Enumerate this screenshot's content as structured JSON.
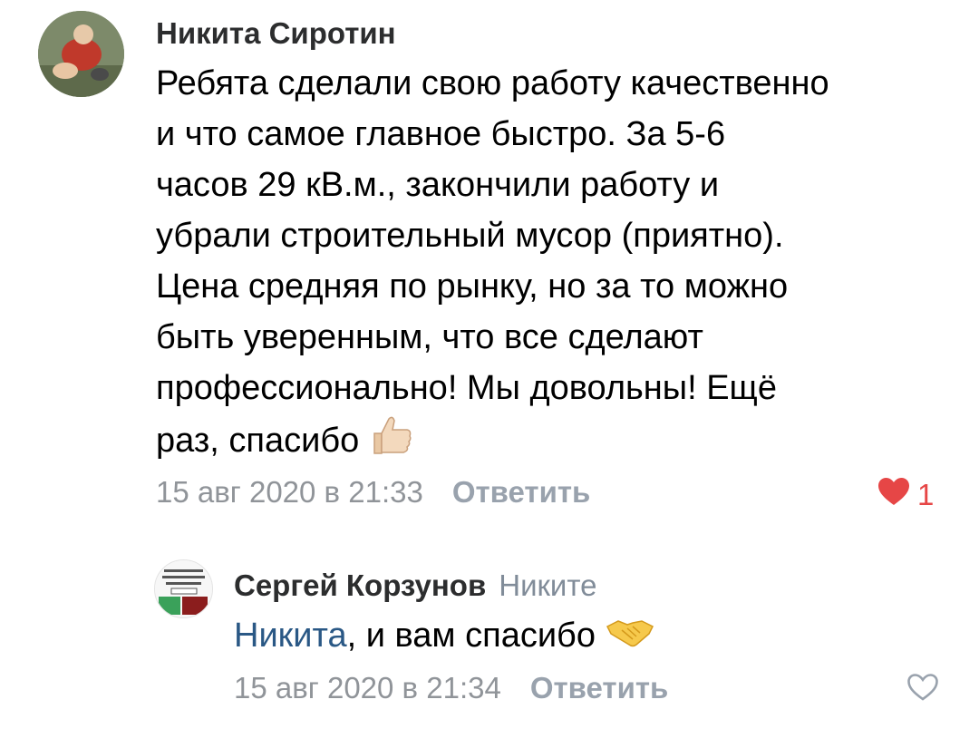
{
  "comments": [
    {
      "author": "Никита Сиротин",
      "text_lines": [
        "Ребята сделали свою работу качественно",
        "и что самое главное быстро. За 5-6",
        "часов 29 кВ.м., закончили работу и",
        "убрали строительный мусор (приятно).",
        "Цена средняя по рынку, но за то можно",
        "быть уверенным, что все сделают",
        "профессионально! Мы довольны! Ещё",
        "раз, спасибо"
      ],
      "emoji": "thumbs-up-icon",
      "date": "15 авг 2020 в 21:33",
      "reply_label": "Ответить",
      "likes": "1",
      "liked": true
    },
    {
      "author": "Сергей Корзунов",
      "to": "Никите",
      "mention": "Никита",
      "text": ", и вам спасибо",
      "emoji": "handshake-icon",
      "date": "15 авг 2020 в 21:34",
      "reply_label": "Ответить",
      "liked": false
    }
  ],
  "colors": {
    "author": "#2c2d2e",
    "secondary": "#909499",
    "reply": "#99a2ad",
    "mention": "#2a5885",
    "like": "#e64646"
  }
}
